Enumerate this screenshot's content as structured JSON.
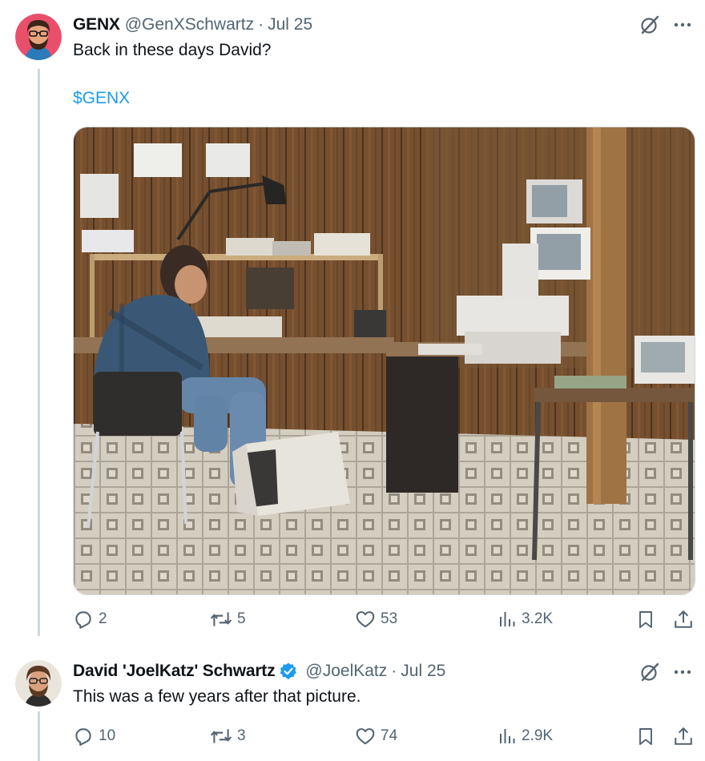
{
  "tweets": [
    {
      "author_name": "GENX",
      "author_handle": "@GenXSchwartz",
      "date": "Jul 25",
      "text": "Back in these days David?",
      "cashtag": "$GENX",
      "media_icon": "photo",
      "stats": {
        "replies": "2",
        "reposts": "5",
        "likes": "53",
        "views": "3.2K"
      }
    },
    {
      "author_name": "David 'JoelKatz' Schwartz",
      "author_handle": "@JoelKatz",
      "date": "Jul 25",
      "verified": true,
      "text": "This was a few years after that picture.",
      "stats": {
        "replies": "10",
        "reposts": "3",
        "likes": "74",
        "views": "2.9K"
      }
    }
  ],
  "separator": "·",
  "colors": {
    "text": "#0f1419",
    "secondary": "#536471",
    "link": "#1d9bf0",
    "thread_line": "#cfd9de",
    "verified": "#1d9bf0"
  },
  "icons": [
    "grok-icon",
    "more-icon",
    "reply-icon",
    "repost-icon",
    "like-icon",
    "views-icon",
    "bookmark-icon",
    "share-icon",
    "verified-badge-icon"
  ]
}
